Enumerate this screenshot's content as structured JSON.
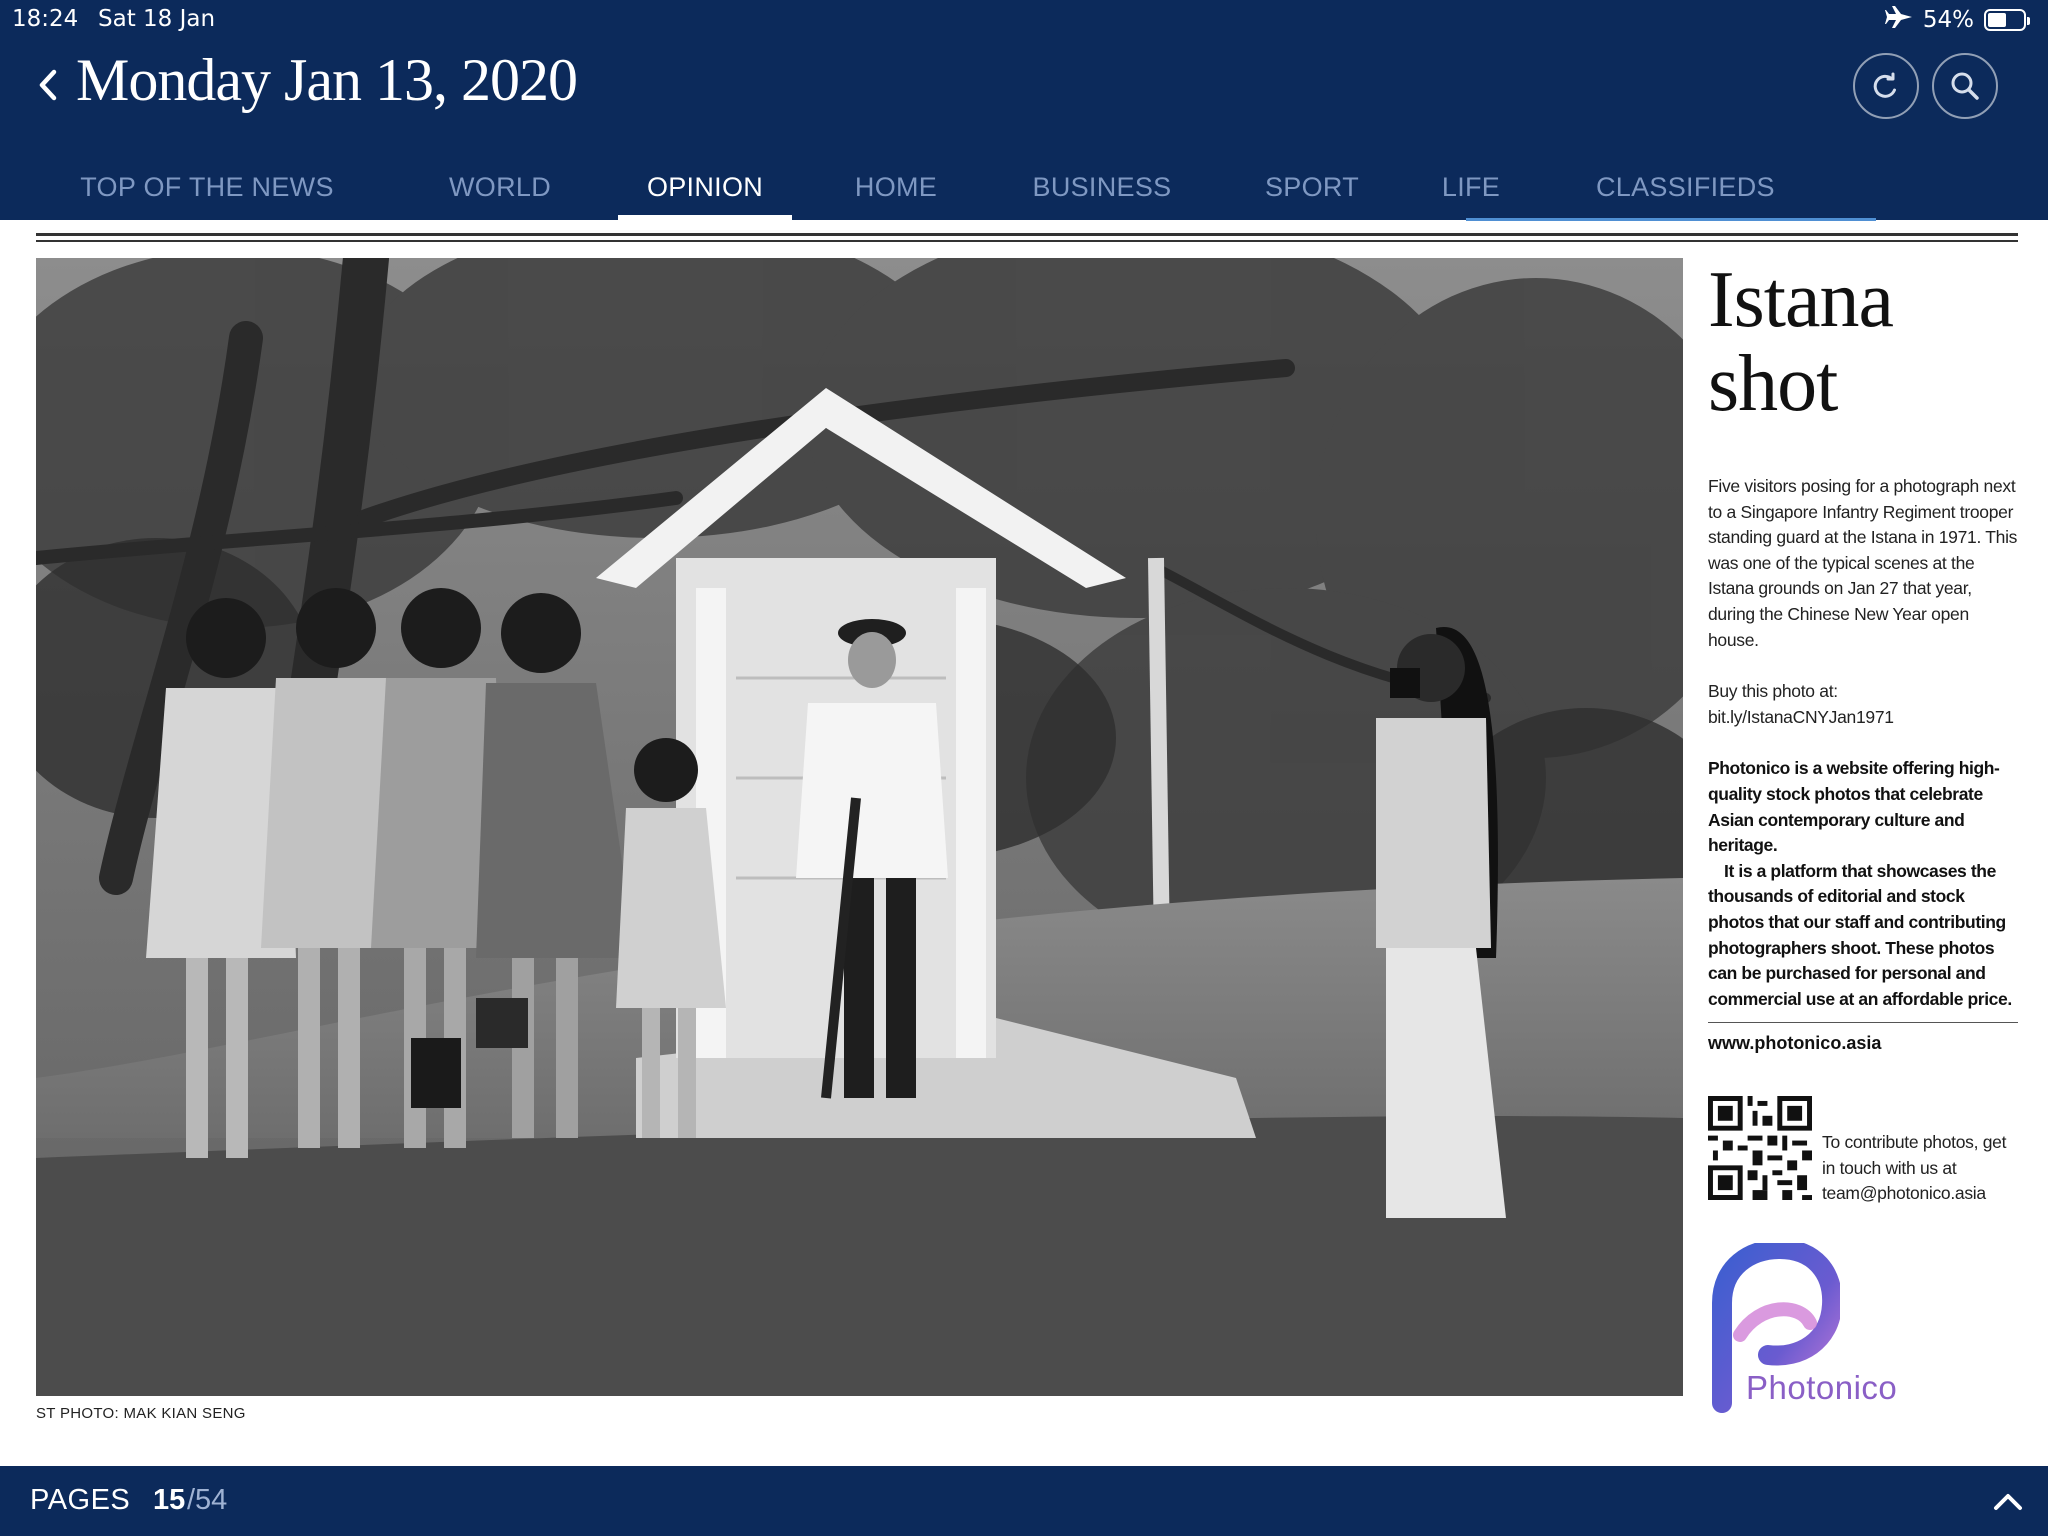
{
  "status_bar": {
    "time": "18:24",
    "date": "Sat 18 Jan",
    "battery": "54%",
    "battery_level": 0.54,
    "airplane_icon": "airplane-icon"
  },
  "header": {
    "issue_date": "Monday Jan 13, 2020",
    "back_icon": "chevron-left-icon",
    "refresh_icon": "refresh-icon",
    "search_icon": "search-icon"
  },
  "nav": {
    "tabs": [
      {
        "label": "TOP OF THE NEWS",
        "active": false
      },
      {
        "label": "WORLD",
        "active": false
      },
      {
        "label": "OPINION",
        "active": true
      },
      {
        "label": "HOME",
        "active": false
      },
      {
        "label": "BUSINESS",
        "active": false
      },
      {
        "label": "SPORT",
        "active": false
      },
      {
        "label": "LIFE",
        "active": false
      },
      {
        "label": "CLASSIFIEDS",
        "active": false
      }
    ]
  },
  "article": {
    "photo_credit": "ST PHOTO: MAK KIAN SENG",
    "headline_line1": "Istana",
    "headline_line2": "shot",
    "caption": "Five visitors posing for a photograph next to a Singapore Infantry Regiment trooper standing guard at the Istana in 1971. This was one of the typical scenes at the Istana grounds on Jan 27 that year, during the Chinese New Year open house.",
    "buy_label": "Buy this photo at:",
    "buy_link": "bit.ly/IstanaCNYJan1971",
    "promo_p1": "Photonico is a website offering high-quality stock photos that celebrate Asian contemporary culture and heritage.",
    "promo_p2": "It is a platform that showcases the thousands of editorial and stock photos that our staff and contributing photographers shoot. These photos can be purchased for personal and commercial use at an affordable price.",
    "site_url": "www.photonico.asia",
    "contribute_text": "To contribute photos, get in touch with us at team@photonico.asia",
    "logo_word": "Photonico"
  },
  "footer": {
    "pages_label": "PAGES",
    "current_page": "15",
    "total_pages": "/54",
    "expand_icon": "chevron-up-icon"
  },
  "colors": {
    "header_bg": "#0c2a5b",
    "tab_inactive": "#7f98c2",
    "tab_active": "#ffffff",
    "logo_purple": "#8a5fc6",
    "logo_blue": "#3c5fd0"
  }
}
